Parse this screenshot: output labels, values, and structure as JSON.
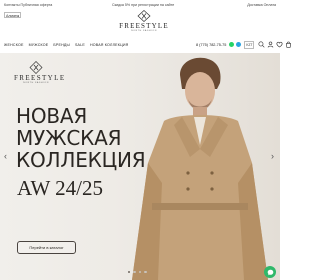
{
  "topbar": {
    "contacts": "Контакты  Публичная оферта",
    "promo": "Скидка 5% при регистрации на сайте",
    "delivery": "Доставка  Оплата"
  },
  "header": {
    "city": "Алматы",
    "logo_text": "FREESTYLE",
    "logo_sub": "NORTH FASHION",
    "phone": "8 (775) 782-75-75",
    "currency": "KZT"
  },
  "nav": {
    "items": [
      "ЖЕНСКОЕ",
      "МУЖСКОЕ",
      "БРЕНДЫ",
      "SALE",
      "НОВАЯ КОЛЛЕКЦИЯ"
    ]
  },
  "hero": {
    "logo_text": "FREESTYLE",
    "logo_sub": "NORTH FASHION",
    "headline": [
      "НОВАЯ",
      "МУЖСКАЯ",
      "КОЛЛЕКЦИЯ"
    ],
    "season": "AW 24/25",
    "cta": "Перейти в каталог",
    "arrow_left": "‹",
    "arrow_right": "›",
    "active_slide": 1,
    "slide_count": 4
  },
  "icons": [
    "whatsapp-icon",
    "telegram-icon",
    "search-icon",
    "user-icon",
    "heart-icon",
    "cart-icon",
    "chat-icon"
  ],
  "colors": {
    "hero_bg": "#eeebe6",
    "whatsapp": "#25d366",
    "telegram": "#2aa3e0",
    "chat": "#2fb86a"
  }
}
